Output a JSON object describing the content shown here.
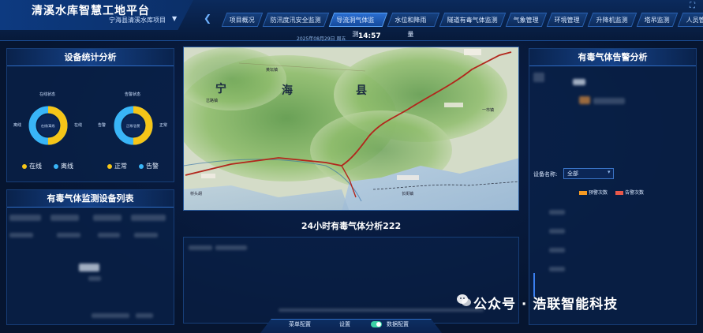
{
  "header": {
    "title": "清溪水库智慧工地平台",
    "project": "宁海县清溪水库项目",
    "date": "2025年08月29日  周五",
    "time": "14:57"
  },
  "nav": {
    "items": [
      {
        "label": "项目概况",
        "active": false
      },
      {
        "label": "防汛度汛安全监测",
        "active": false
      },
      {
        "label": "导流洞气体监测",
        "active": true
      },
      {
        "label": "水位和降雨量",
        "active": false
      },
      {
        "label": "隧道有毒气体监测",
        "active": false
      },
      {
        "label": "气象管理",
        "active": false
      },
      {
        "label": "环境管理",
        "active": false
      },
      {
        "label": "升降机监测",
        "active": false
      },
      {
        "label": "塔吊监测",
        "active": false
      },
      {
        "label": "人员管",
        "active": false
      }
    ]
  },
  "device_stats": {
    "title": "设备统计分析",
    "donut1": {
      "top_label": "在线状态",
      "center": "在线/离线",
      "left": "离线",
      "right": "在线",
      "online_fraction": 0.5
    },
    "donut2": {
      "top_label": "告警状态",
      "center": "正常/告警",
      "left": "告警",
      "right": "正常",
      "normal_fraction": 0.5
    },
    "legend1": [
      "在线",
      "离线"
    ],
    "legend2": [
      "正常",
      "告警"
    ],
    "colors": {
      "yellow": "#f5c518",
      "blue": "#39b5f7"
    }
  },
  "device_list": {
    "title": "有毒气体监测设备列表"
  },
  "map": {
    "labels": [
      "宁",
      "海",
      "县"
    ],
    "places": [
      "黄坛镇",
      "岔路镇",
      "桥头胡",
      "一市镇",
      "长街镇"
    ]
  },
  "center": {
    "title": "24小时有毒气体分析222"
  },
  "bottom_bar": {
    "items": [
      "菜单配置",
      "设置",
      "数据配置"
    ]
  },
  "alarm": {
    "title": "有毒气体告警分析",
    "device_label": "设备名称:",
    "device_value": "全部",
    "legend": [
      {
        "label": "预警次数",
        "color": "#f59a23"
      },
      {
        "label": "告警次数",
        "color": "#e8584a"
      }
    ]
  },
  "watermark": "公众号 · 浩联智能科技"
}
